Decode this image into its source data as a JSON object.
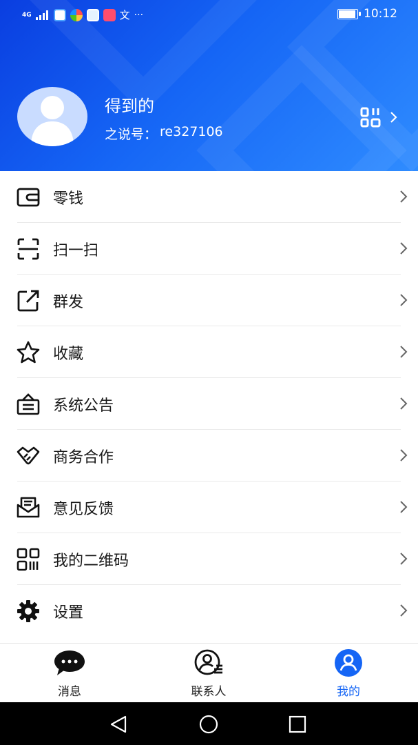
{
  "status_bar": {
    "network": "4G",
    "time": "10:12",
    "battery_level": 0.84,
    "notification_icons": [
      "browser-icon",
      "pinwheel-icon",
      "mail-app-icon",
      "book-app-icon",
      "text-app-icon",
      "more-dots-icon"
    ]
  },
  "profile": {
    "name": "得到的",
    "id_label": "之说号：",
    "id_value": "re327106"
  },
  "menu": [
    {
      "label": "零钱",
      "icon": "wallet-icon"
    },
    {
      "label": "扫一扫",
      "icon": "scan-icon"
    },
    {
      "label": "群发",
      "icon": "share-out-icon"
    },
    {
      "label": "收藏",
      "icon": "star-icon"
    },
    {
      "label": "系统公告",
      "icon": "notice-board-icon"
    },
    {
      "label": "商务合作",
      "icon": "handshake-icon"
    },
    {
      "label": "意见反馈",
      "icon": "feedback-envelope-icon"
    },
    {
      "label": "我的二维码",
      "icon": "qr-code-icon"
    },
    {
      "label": "设置",
      "icon": "gear-icon"
    }
  ],
  "tabs": [
    {
      "label": "消息",
      "icon": "chat-bubble-icon",
      "active": false
    },
    {
      "label": "联系人",
      "icon": "contacts-icon",
      "active": false
    },
    {
      "label": "我的",
      "icon": "user-profile-icon",
      "active": true
    }
  ],
  "colors": {
    "header_start": "#0a3ee0",
    "header_end": "#2f8cff",
    "active_tab": "#1565f5",
    "text_primary": "#1a1a1a"
  }
}
